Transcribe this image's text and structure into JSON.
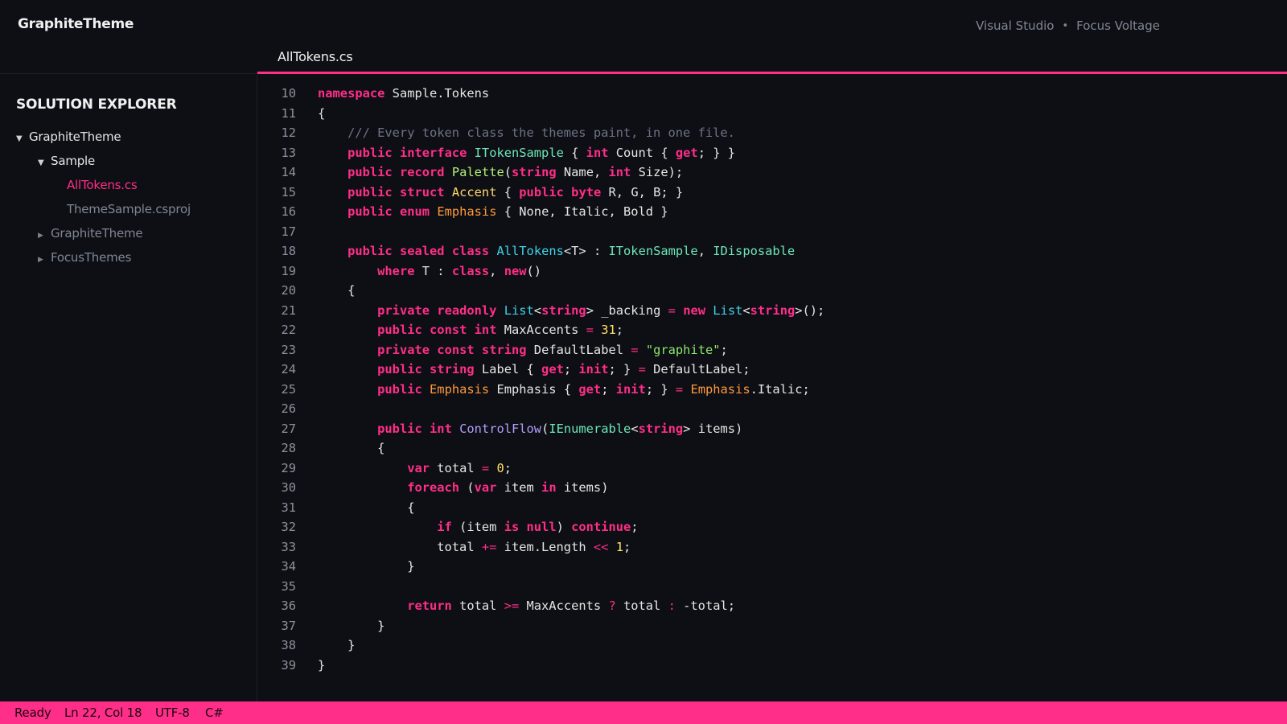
{
  "app": {
    "title": "GraphiteTheme",
    "meta_left": "Visual Studio",
    "meta_sep": "•",
    "meta_right": "Focus Voltage"
  },
  "colors": {
    "accent": "#ff2e88",
    "background": "#0d0f14",
    "keyword": "#ff2e88",
    "class": "#3fd4e8",
    "interface": "#6ee7b7",
    "struct": "#ffd86b",
    "enum": "#ff9a3d",
    "record": "#b5f27a",
    "method": "#b39cff",
    "string": "#8de66b",
    "number": "#ffe066",
    "comment": "#6c7384"
  },
  "sidebar": {
    "header": "SOLUTION EXPLORER",
    "items": [
      {
        "label": "GraphiteTheme",
        "expanded": "true"
      },
      {
        "label": "Sample",
        "expanded": "true"
      },
      {
        "label": "AllTokens.cs",
        "selected": "true"
      },
      {
        "label": "ThemeSample.csproj"
      },
      {
        "label": "GraphiteTheme",
        "expanded": "false"
      },
      {
        "label": "FocusThemes",
        "expanded": "false"
      }
    ]
  },
  "tabs": [
    {
      "label": "AllTokens.cs",
      "active": "true"
    }
  ],
  "editor": {
    "lines": [
      {
        "n": "10",
        "code": "namespace Sample.Tokens"
      },
      {
        "n": "11",
        "code": "{"
      },
      {
        "n": "12",
        "code": "    /// Every token class the themes paint, in one file."
      },
      {
        "n": "13",
        "code": "    public interface ITokenSample { int Count { get; } }"
      },
      {
        "n": "14",
        "code": "    public record Palette(string Name, int Size);"
      },
      {
        "n": "15",
        "code": "    public struct Accent { public byte R, G, B; }"
      },
      {
        "n": "16",
        "code": "    public enum Emphasis { None, Italic, Bold }"
      },
      {
        "n": "17",
        "code": ""
      },
      {
        "n": "18",
        "code": "    public sealed class AllTokens<T> : ITokenSample, IDisposable"
      },
      {
        "n": "19",
        "code": "        where T : class, new()"
      },
      {
        "n": "20",
        "code": "    {"
      },
      {
        "n": "21",
        "code": "        private readonly List<string> _backing = new List<string>();"
      },
      {
        "n": "22",
        "code": "        public const int MaxAccents = 31;"
      },
      {
        "n": "23",
        "code": "        private const string DefaultLabel = \"graphite\";"
      },
      {
        "n": "24",
        "code": "        public string Label { get; init; } = DefaultLabel;"
      },
      {
        "n": "25",
        "code": "        public Emphasis Emphasis { get; init; } = Emphasis.Italic;"
      },
      {
        "n": "26",
        "code": ""
      },
      {
        "n": "27",
        "code": "        public int ControlFlow(IEnumerable<string> items)"
      },
      {
        "n": "28",
        "code": "        {"
      },
      {
        "n": "29",
        "code": "            var total = 0;"
      },
      {
        "n": "30",
        "code": "            foreach (var item in items)"
      },
      {
        "n": "31",
        "code": "            {"
      },
      {
        "n": "32",
        "code": "                if (item is null) continue;"
      },
      {
        "n": "33",
        "code": "                total += item.Length << 1;"
      },
      {
        "n": "34",
        "code": "            }"
      },
      {
        "n": "35",
        "code": ""
      },
      {
        "n": "36",
        "code": "            return total >= MaxAccents ? total : -total;"
      },
      {
        "n": "37",
        "code": "        }"
      },
      {
        "n": "38",
        "code": "    }"
      },
      {
        "n": "39",
        "code": "}"
      }
    ]
  },
  "status": {
    "state": "Ready",
    "position": "Ln 22, Col 18",
    "encoding": "UTF-8",
    "language": "C#"
  }
}
